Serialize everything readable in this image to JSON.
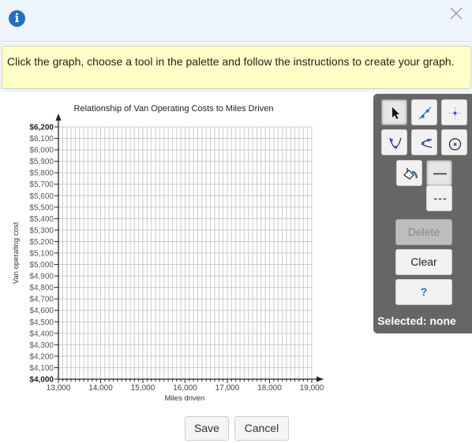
{
  "header": {
    "info_icon": "info-icon",
    "close_icon": "close-icon"
  },
  "instructions": "Click the graph, choose a tool in the palette and follow the instructions to create your graph.",
  "palette": {
    "tools": [
      {
        "name": "select-tool",
        "icon": "arrow-cursor-icon",
        "selected": true
      },
      {
        "name": "line-tool",
        "icon": "line-icon",
        "selected": false
      },
      {
        "name": "point-tool",
        "icon": "point-icon",
        "selected": false
      },
      {
        "name": "parabola-tool",
        "icon": "parabola-icon",
        "selected": false
      },
      {
        "name": "sideways-parabola-tool",
        "icon": "sideways-parabola-icon",
        "selected": false
      },
      {
        "name": "circle-tool",
        "icon": "circle-icon",
        "selected": false
      },
      {
        "name": "fill-tool",
        "icon": "paint-bucket-icon",
        "selected": false
      },
      {
        "name": "solid-line-style",
        "icon": "solid-line-icon",
        "selected": true
      },
      {
        "name": "dashed-line-style",
        "icon": "dashed-line-icon",
        "selected": false
      }
    ],
    "delete_label": "Delete",
    "clear_label": "Clear",
    "help_label": "?",
    "selected_status": "Selected: none"
  },
  "buttons": {
    "save_label": "Save",
    "cancel_label": "Cancel"
  },
  "colors": {
    "accent": "#1f6fc5",
    "palette_bg": "#666666",
    "instruction_bg": "#ffffc8",
    "grid": "#cccccc"
  },
  "chart_data": {
    "type": "scatter",
    "title": "Relationship of Van Operating Costs to Miles Driven",
    "xlabel": "Miles driven",
    "ylabel": "Van operating cost",
    "xlim": [
      13000,
      19000
    ],
    "ylim": [
      4000,
      6200
    ],
    "x_ticks": [
      13000,
      14000,
      15000,
      16000,
      17000,
      18000,
      19000
    ],
    "x_tick_labels": [
      "13,000",
      "14,000",
      "15,000",
      "16,000",
      "17,000",
      "18,000",
      "19,000"
    ],
    "x_minor_step": 100,
    "y_ticks": [
      4000,
      4100,
      4200,
      4300,
      4400,
      4500,
      4600,
      4700,
      4800,
      4900,
      5000,
      5100,
      5200,
      5300,
      5400,
      5500,
      5600,
      5700,
      5800,
      5900,
      6000,
      6100,
      6200
    ],
    "y_tick_labels": [
      "$4,000",
      "$4,100",
      "$4,200",
      "$4,300",
      "$4,400",
      "$4,500",
      "$4,600",
      "$4,700",
      "$4,800",
      "$4,900",
      "$5,000",
      "$5,100",
      "$5,200",
      "$5,300",
      "$5,400",
      "$5,500",
      "$5,600",
      "$5,700",
      "$5,800",
      "$5,900",
      "$6,000",
      "$6,100",
      "$6,200"
    ],
    "grid": true,
    "series": [],
    "legend": "none"
  }
}
